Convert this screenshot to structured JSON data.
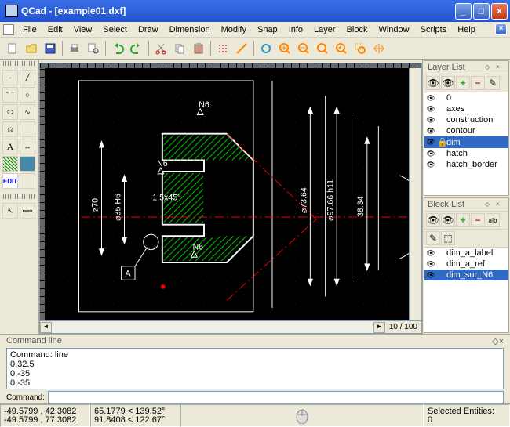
{
  "window": {
    "title": "QCad - [example01.dxf]"
  },
  "menu": [
    "File",
    "Edit",
    "View",
    "Select",
    "Draw",
    "Dimension",
    "Modify",
    "Snap",
    "Info",
    "Layer",
    "Block",
    "Window",
    "Scripts",
    "Help"
  ],
  "zoom": "10 / 100",
  "layer_panel": {
    "title": "Layer List",
    "items": [
      {
        "name": "0",
        "sel": false
      },
      {
        "name": "axes",
        "sel": false
      },
      {
        "name": "construction",
        "sel": false
      },
      {
        "name": "contour",
        "sel": false
      },
      {
        "name": "dim",
        "sel": true,
        "locked": true
      },
      {
        "name": "hatch",
        "sel": false
      },
      {
        "name": "hatch_border",
        "sel": false
      }
    ]
  },
  "block_panel": {
    "title": "Block List",
    "items": [
      {
        "name": "dim_a_label",
        "sel": false
      },
      {
        "name": "dim_a_ref",
        "sel": false
      },
      {
        "name": "dim_sur_N6",
        "sel": true
      }
    ]
  },
  "cmdline": {
    "title": "Command line",
    "history": [
      "Command: line",
      "0,32.5",
      "0,-35",
      "0,-35"
    ],
    "prompt": "Command:"
  },
  "status": {
    "abs1": "-49.5799 , 42.3082",
    "abs2": "-49.5799 , 77.3082",
    "rel1": "65.1779 < 139.52°",
    "rel2": "91.8408 < 122.67°",
    "sel": "Selected Entities:",
    "selcount": "0"
  },
  "drawing_labels": {
    "d70": "⌀70",
    "d35": "⌀35 H6",
    "d73": "⌀73.64",
    "d97": "⌀97.66 h11",
    "d38": "38.34",
    "chamfer": "1.5x45°",
    "a": "A",
    "n6a": "N6",
    "n6b": "N6",
    "n6c": "N6"
  }
}
